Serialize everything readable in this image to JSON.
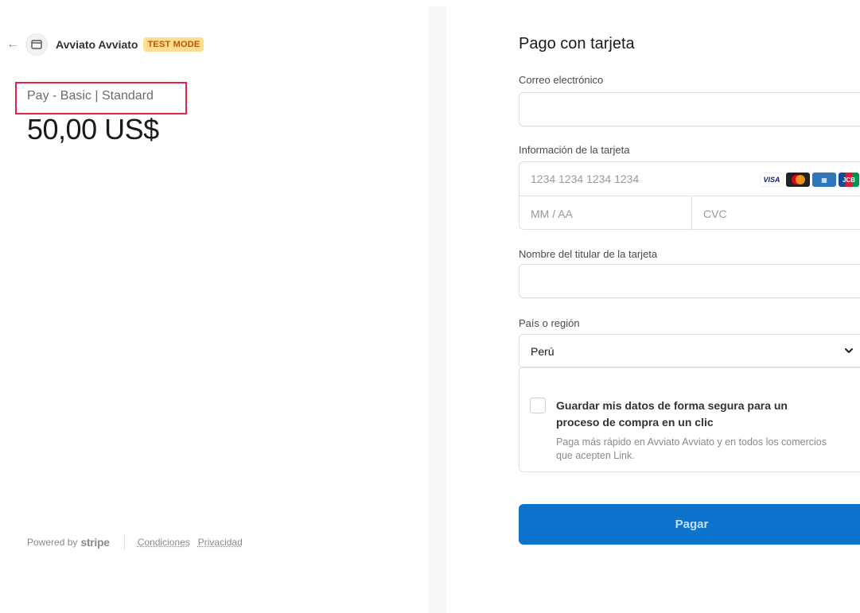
{
  "merchant": {
    "name": "Avviato Avviato",
    "test_badge": "TEST MODE",
    "icons": {
      "back": "arrow-left-icon",
      "store": "store-icon"
    }
  },
  "product": {
    "name": "Pay - Basic | Standard",
    "price": "50,00 US$"
  },
  "footer": {
    "powered_by": "Powered by",
    "brand": "stripe",
    "terms": "Condiciones",
    "privacy": "Privacidad"
  },
  "form": {
    "title": "Pago con tarjeta",
    "email_label": "Correo electrónico",
    "email_value": "",
    "card_label": "Información de la tarjeta",
    "card_number_placeholder": "1234 1234 1234 1234",
    "expiry_placeholder": "MM / AA",
    "cvc_placeholder": "CVC",
    "card_brands": [
      "VISA",
      "Mastercard",
      "Amex",
      "JCB"
    ],
    "cardholder_label": "Nombre del titular de la tarjeta",
    "cardholder_value": "",
    "country_label": "País o región",
    "country_value": "Perú",
    "save_title": "Guardar mis datos de forma segura para un proceso de compra en un clic",
    "save_subtitle": "Paga más rápido en Avviato Avviato y en todos los comercios que acepten Link.",
    "save_checked": false,
    "pay_button": "Pagar"
  },
  "colors": {
    "accent": "#0d74ce",
    "test_badge_bg": "#ffde92",
    "test_badge_text": "#bb5504",
    "highlight_border": "#e0244a"
  }
}
